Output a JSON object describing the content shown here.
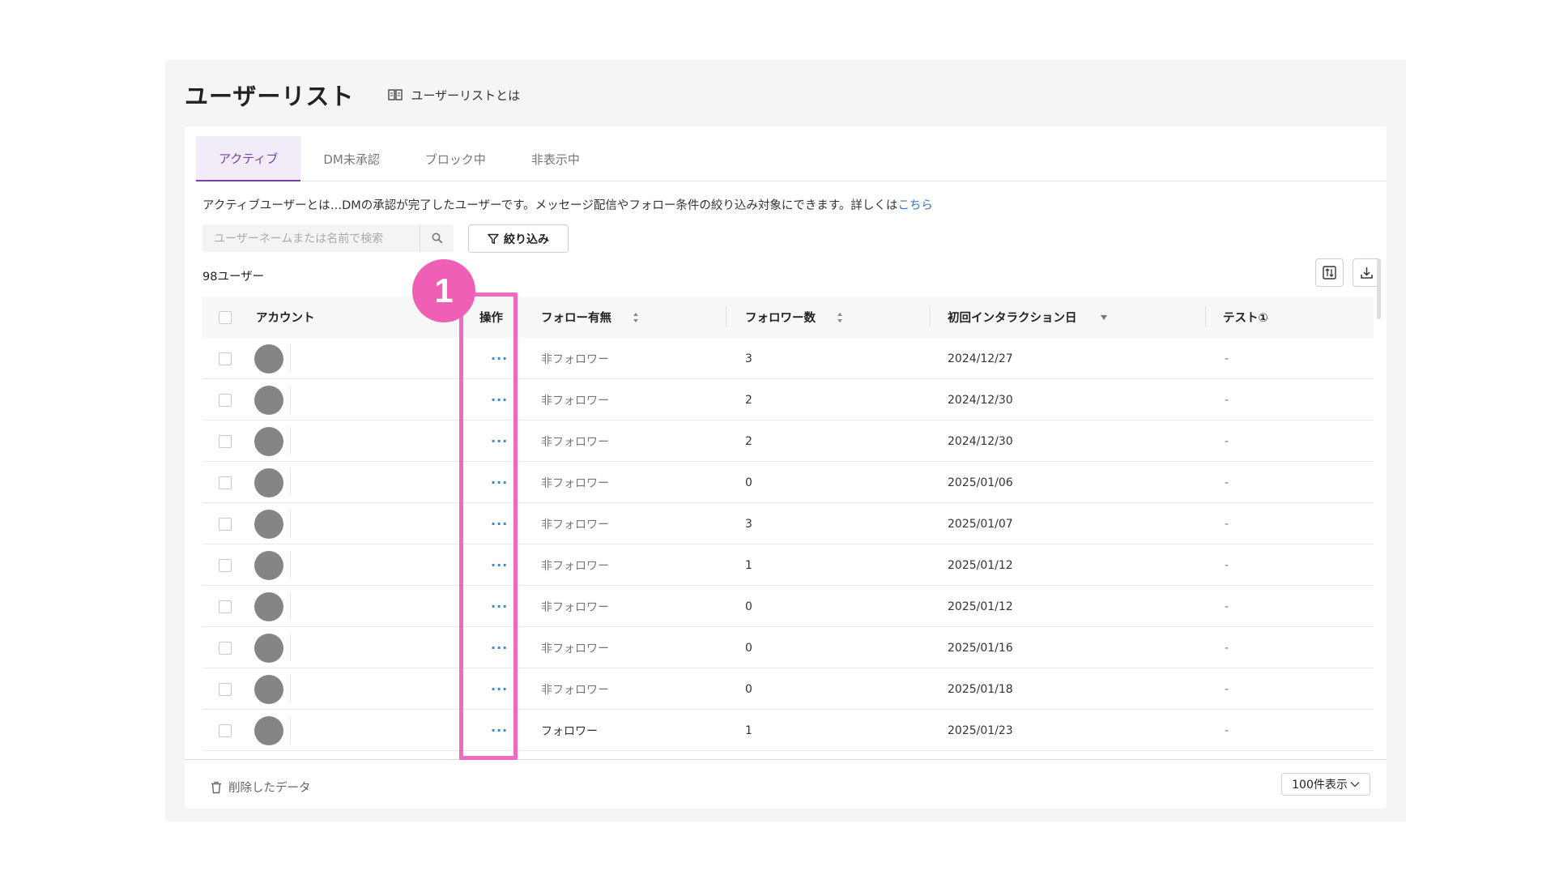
{
  "page": {
    "title": "ユーザーリスト",
    "help_link": "ユーザーリストとは"
  },
  "tabs": [
    {
      "label": "アクティブ",
      "active": true
    },
    {
      "label": "DM未承認",
      "active": false
    },
    {
      "label": "ブロック中",
      "active": false
    },
    {
      "label": "非表示中",
      "active": false
    }
  ],
  "description": {
    "text": "アクティブユーザーとは…DMの承認が完了したユーザーです。メッセージ配信やフォロー条件の絞り込み対象にできます。詳しくは",
    "link": "こちら"
  },
  "search": {
    "placeholder": "ユーザーネームまたは名前で検索"
  },
  "filter_label": "絞り込み",
  "user_count": "98ユーザー",
  "table": {
    "columns": {
      "account": "アカウント",
      "action": "操作",
      "follow": "フォロー有無",
      "followers": "フォロワー数",
      "first_interaction": "初回インタラクション日",
      "test": "テスト①"
    },
    "rows": [
      {
        "action": "···",
        "follow": "非フォロワー",
        "followers": "3",
        "date": "2024/12/27",
        "test": "-"
      },
      {
        "action": "···",
        "follow": "非フォロワー",
        "followers": "2",
        "date": "2024/12/30",
        "test": "-"
      },
      {
        "action": "···",
        "follow": "非フォロワー",
        "followers": "2",
        "date": "2024/12/30",
        "test": "-"
      },
      {
        "action": "···",
        "follow": "非フォロワー",
        "followers": "0",
        "date": "2025/01/06",
        "test": "-"
      },
      {
        "action": "···",
        "follow": "非フォロワー",
        "followers": "3",
        "date": "2025/01/07",
        "test": "-"
      },
      {
        "action": "···",
        "follow": "非フォロワー",
        "followers": "1",
        "date": "2025/01/12",
        "test": "-"
      },
      {
        "action": "···",
        "follow": "非フォロワー",
        "followers": "0",
        "date": "2025/01/12",
        "test": "-"
      },
      {
        "action": "···",
        "follow": "非フォロワー",
        "followers": "0",
        "date": "2025/01/16",
        "test": "-"
      },
      {
        "action": "···",
        "follow": "非フォロワー",
        "followers": "0",
        "date": "2025/01/18",
        "test": "-"
      },
      {
        "action": "···",
        "follow": "フォロワー",
        "followers": "1",
        "date": "2025/01/23",
        "test": "-"
      }
    ]
  },
  "footer": {
    "deleted_data": "削除したデータ",
    "per_page": "100件表示"
  },
  "annotation": {
    "number": "1",
    "color": "#ef5fb6"
  },
  "colors": {
    "accent": "#7a3fa8",
    "link": "#3a73c4",
    "highlight": "#f06bbf"
  }
}
